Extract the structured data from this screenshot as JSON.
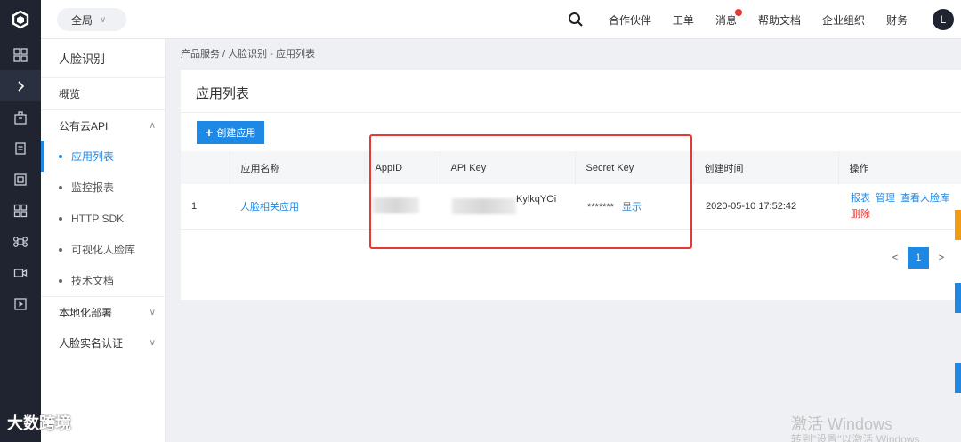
{
  "scope": {
    "label": "全局"
  },
  "topnav": {
    "items": [
      "合作伙伴",
      "工单",
      "消息",
      "帮助文档",
      "企业组织",
      "财务"
    ],
    "avatar": "L"
  },
  "sidebar": {
    "title": "人脸识别",
    "overview": "概览",
    "group_public": "公有云API",
    "sub": [
      "应用列表",
      "监控报表",
      "HTTP SDK",
      "可视化人脸库",
      "技术文档"
    ],
    "group_local": "本地化部署",
    "group_realname": "人脸实名认证"
  },
  "breadcrumb": "产品服务 / 人脸识别 - 应用列表",
  "panel": {
    "title": "应用列表",
    "create_button": "创建应用"
  },
  "table": {
    "headers": [
      "",
      "应用名称",
      "AppID",
      "API Key",
      "Secret Key",
      "创建时间",
      "操作"
    ],
    "rows": [
      {
        "index": "1",
        "name": "人脸相关应用",
        "api_key_tail": "KylkqYOi",
        "secret_masked": "*******",
        "secret_show": "显示",
        "created": "2020-05-10 17:52:42",
        "ops": [
          "报表",
          "管理",
          "查看人脸库",
          "删除"
        ]
      }
    ]
  },
  "pager": {
    "prev": "<",
    "current": "1",
    "next": ">"
  },
  "watermarks": {
    "brand": "大数跨境",
    "windows_line1": "激活 Windows",
    "windows_line2": "转到\"设置\"以激活 Windows"
  },
  "colors": {
    "accent": "#1e88e5",
    "highlight": "#e53935",
    "rail": "#1f2430"
  }
}
